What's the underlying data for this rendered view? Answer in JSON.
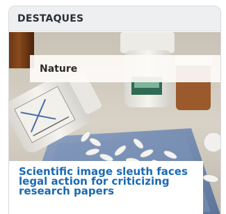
{
  "widget": {
    "title": "DESTAQUES"
  },
  "story": {
    "tag": "Nature",
    "headline": "Scientific image sleuth faces legal action for criticizing research papers",
    "image_description": "pills-and-medicine-bottles-photo"
  },
  "colors": {
    "header_bg": "#eeeff1",
    "headline": "#1a6ab3",
    "tag_text": "#2b2b2b"
  }
}
